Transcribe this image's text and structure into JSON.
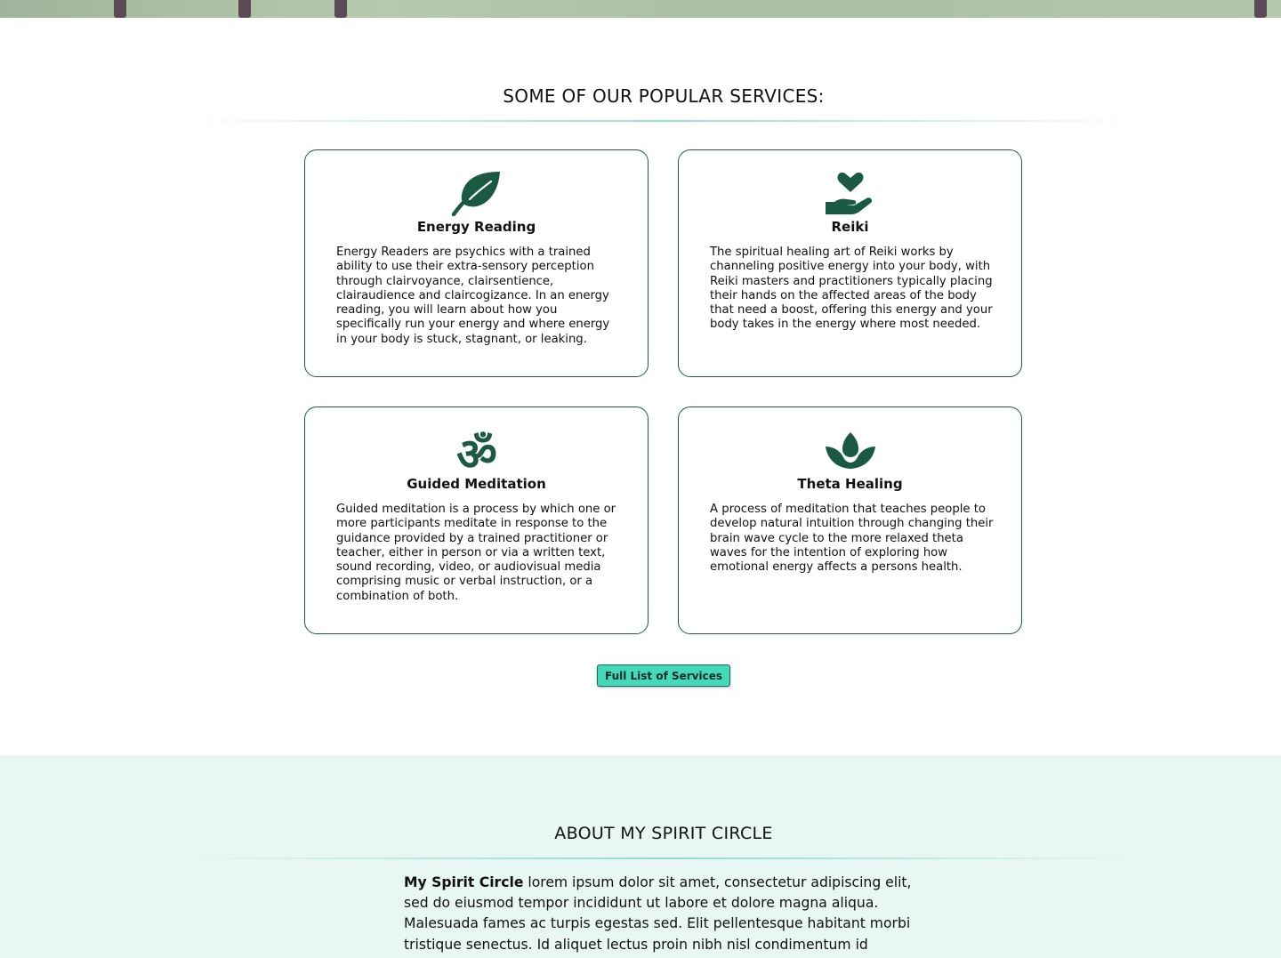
{
  "services": {
    "heading": "SOME OF OUR POPULAR SERVICES:",
    "cards": [
      {
        "icon": "leaf-icon",
        "title": "Energy Reading",
        "text": "Energy Readers are psychics with a trained ability to use their extra-sensory perception through clairvoyance, clairsentience, clairaudience and claircogizance. In an energy reading, you will learn about how you specifically run your energy and where energy in your body is stuck, stagnant, or leaking."
      },
      {
        "icon": "hand-holding-heart-icon",
        "title": "Reiki",
        "text": "The spiritual healing art of Reiki works by channeling positive energy into your body, with Reiki masters and practitioners typically placing their hands on the affected areas of the body that need a boost, offering this energy and your body takes in the energy where most needed."
      },
      {
        "icon": "om-icon",
        "title": "Guided Meditation",
        "text": "Guided meditation is a process by which one or more participants meditate in response to the guidance provided by a trained practitioner or teacher, either in person or via a written text, sound recording, video, or audiovisual media comprising music or verbal instruction, or a combination of both."
      },
      {
        "icon": "lotus-icon",
        "title": "Theta Healing",
        "text": "A process of meditation that teaches people to develop natural intuition through changing their brain wave cycle to the more relaxed theta waves for the intention of exploring how emotional energy affects a persons health."
      }
    ],
    "button_label": "Full List of Services"
  },
  "about": {
    "heading": "ABOUT MY SPIRIT CIRCLE",
    "brand": "My Spirit Circle",
    "text": " lorem ipsum dolor sit amet, consectetur adipiscing elit, sed do eiusmod tempor incididunt ut labore et dolore magna aliqua. Malesuada fames ac turpis egestas sed. Elit pellentesque habitant morbi tristique senectus. Id aliquet lectus proin nibh nisl condimentum id"
  },
  "colors": {
    "icon_green": "#1a5a42",
    "accent": "#45d9bb",
    "about_bg": "#e8f7f3"
  }
}
